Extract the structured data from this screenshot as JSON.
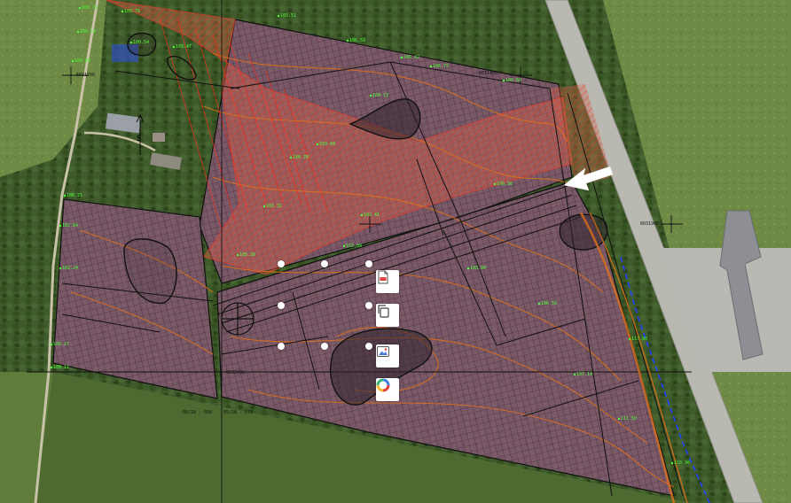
{
  "map": {
    "colors": {
      "forest": "#3f5a2b",
      "field": "#6e8a45",
      "field_light": "#8aa35a",
      "plot_fill": "#8a5a78",
      "grid_line": "#4a2a40",
      "hatch": "#e23a2a",
      "contour": "#e0701a",
      "label_green": "#4cff3a",
      "road": "#b9b9b2",
      "building": "#8d8f95"
    },
    "spot_labels": [
      "100.74",
      "100.53",
      "100.60",
      "100.79",
      "103.47",
      "100.21",
      "102.84",
      "102.24",
      "100.27",
      "100.11",
      "100.54",
      "103.51",
      "106.59",
      "106.42",
      "106.72",
      "109.60",
      "100.13",
      "103.04",
      "101.31",
      "102.41",
      "105.30",
      "106.50",
      "100.78",
      "103.09",
      "103.90",
      "106.50",
      "107.14",
      "111.50",
      "117.80",
      "110.90"
    ],
    "grid_refs": [
      "6031700",
      "6031800",
      "6031900",
      "6032000"
    ],
    "section_labels": [
      "05/28 - 050",
      "05/28 - 071"
    ],
    "north_marker": "S"
  },
  "toolbar": {
    "items": [
      {
        "name": "pdf-export",
        "icon": "document-icon"
      },
      {
        "name": "copy",
        "icon": "copy-icon"
      },
      {
        "name": "image-export",
        "icon": "image-icon"
      },
      {
        "name": "color-wheel",
        "icon": "color-wheel-icon"
      }
    ]
  },
  "selection": {
    "handle_count": 8
  }
}
